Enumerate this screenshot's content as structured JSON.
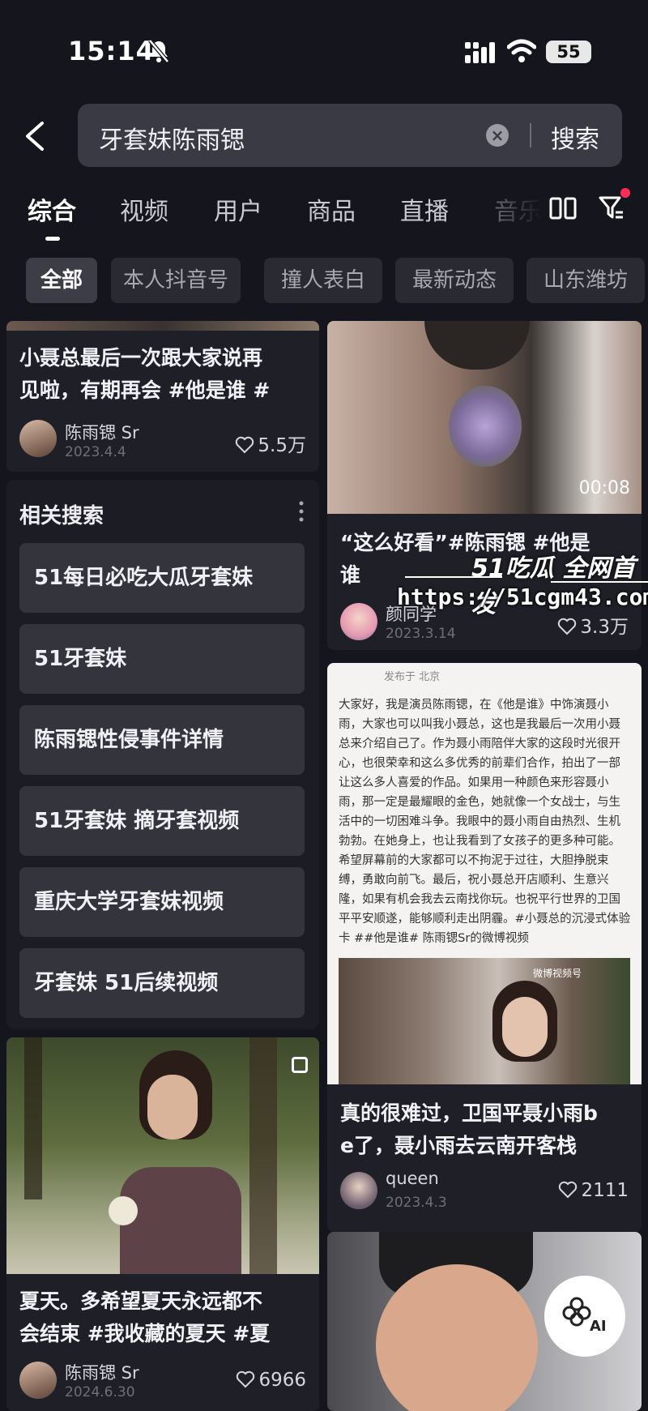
{
  "status_bar": {
    "time": "15:14",
    "battery": "55",
    "icons": [
      "bell-muted-icon",
      "signal-icon",
      "wifi-icon",
      "battery-icon"
    ]
  },
  "search": {
    "query": "牙套妹陈雨锶",
    "submit_label": "搜索"
  },
  "tabs": [
    {
      "label": "综合",
      "active": true
    },
    {
      "label": "视频"
    },
    {
      "label": "用户"
    },
    {
      "label": "商品"
    },
    {
      "label": "直播"
    },
    {
      "label": "音乐"
    }
  ],
  "chips": [
    {
      "label": "全部",
      "active": true
    },
    {
      "label": "本人抖音号"
    },
    {
      "label": "撞人表白"
    },
    {
      "label": "最新动态"
    },
    {
      "label": "山东潍坊"
    }
  ],
  "cards": {
    "c1": {
      "caption_line1": "小聂总最后一次跟大家说再",
      "caption_line2": "见啦，有期再会 #他是谁 #",
      "author": "陈雨锶 Sr",
      "date": "2023.4.4",
      "likes": "5.5万"
    },
    "c2": {
      "duration": "00:08",
      "caption_line1": "“这么好看”#陈雨锶  #他是",
      "caption_line2": "谁",
      "author": "颜同学",
      "date": "2023.3.14",
      "likes": "3.3万"
    },
    "c3": {
      "post_header": "发布于 北京",
      "post_body": "大家好，我是演员陈雨锶，在《他是谁》中饰演聂小雨，大家也可以叫我小聂总，这也是我最后一次用小聂总来介绍自己了。作为聂小雨陪伴大家的这段时光很开心，也很荣幸和这么多优秀的前辈们合作，拍出了一部让这么多人喜爱的作品。如果用一种颜色来形容聂小雨，那一定是最耀眼的金色，她就像一个女战士，与生活中的一切困难斗争。我眼中的聂小雨自由热烈、生机勃勃。在她身上，也让我看到了女孩子的更多种可能。希望屏幕前的大家都可以不拘泥于过往，大胆挣脱束缚，勇敢向前飞。最后，祝小聂总开店顺利、生意兴隆，如果有机会我去云南找你玩。也祝平行世界的卫国平平安顺遂，能够顺利走出阴霾。#小聂总的沉浸式体验卡 ##他是谁# 陈雨锶Sr的微博视频",
      "video_badge": "微博视频号",
      "caption_line1": "真的很难过，卫国平聂小雨b",
      "caption_line2": "e了，聂小雨去云南开客栈",
      "author": "queen",
      "date": "2023.4.3",
      "likes": "2111"
    },
    "c4": {
      "caption_line1": "夏天。多希望夏天永远都不",
      "caption_line2": "会结束 #我收藏的夏天 #夏",
      "author": "陈雨锶 Sr",
      "date": "2024.6.30",
      "likes": "6966"
    }
  },
  "related": {
    "title": "相关搜索",
    "items": [
      "51每日必吃大瓜牙套妹",
      "51牙套妹",
      "陈雨锶性侵事件详情",
      "51牙套妹 摘牙套视频",
      "重庆大学牙套妹视频",
      "牙套妹 51后续视频"
    ]
  },
  "watermark": {
    "brand": "51吃瓜 全网首发",
    "url": "https://51cgm43.com"
  },
  "ai_button": {
    "label": "AI"
  },
  "colors": {
    "background": "#15151d",
    "card": "#1f1f28",
    "chip": "#2a2a33",
    "accent": "#fe2c55"
  }
}
